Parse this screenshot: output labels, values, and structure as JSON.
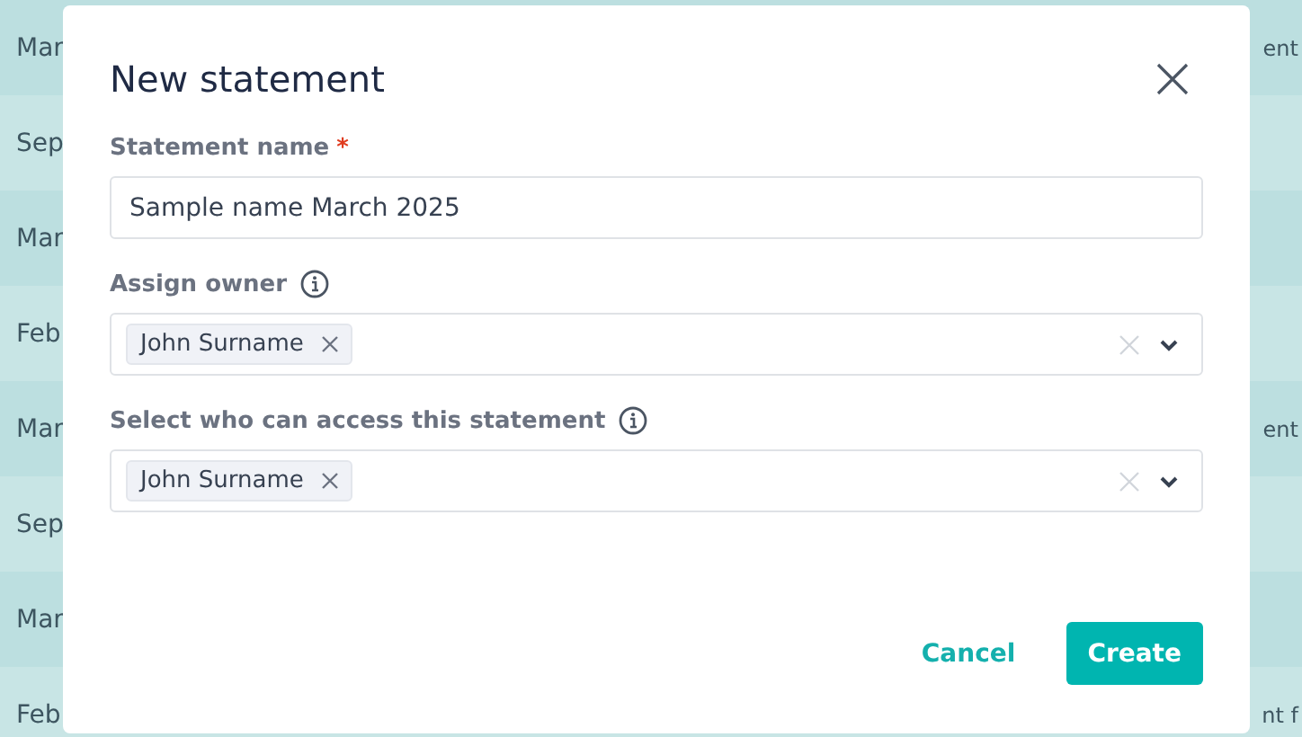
{
  "background_rows": [
    {
      "column_1": "Mar",
      "column_2": "ent"
    },
    {
      "column_1": "Sep"
    },
    {
      "column_1": "Mar"
    },
    {
      "column_1": "Feb"
    },
    {
      "column_1": "Mar",
      "column_2": "ent"
    },
    {
      "column_1": "Sep"
    },
    {
      "column_1": "Mar"
    },
    {
      "column_1": "Feb",
      "column_2": "nt f"
    }
  ],
  "dialog": {
    "title": "New statement",
    "fields": [
      {
        "kind": "text",
        "label": "Statement name",
        "required_mark": "*",
        "value": "Sample name March 2025"
      },
      {
        "kind": "multiselect",
        "label": "Assign owner",
        "info": true,
        "tags": [
          "John Surname"
        ]
      },
      {
        "kind": "multiselect",
        "label": "Select who can access this statement",
        "info": true,
        "tags": [
          "John Surname"
        ]
      }
    ],
    "buttons": [
      {
        "kind": "secondary",
        "label": "Cancel"
      },
      {
        "kind": "primary",
        "label": "Create"
      }
    ]
  }
}
